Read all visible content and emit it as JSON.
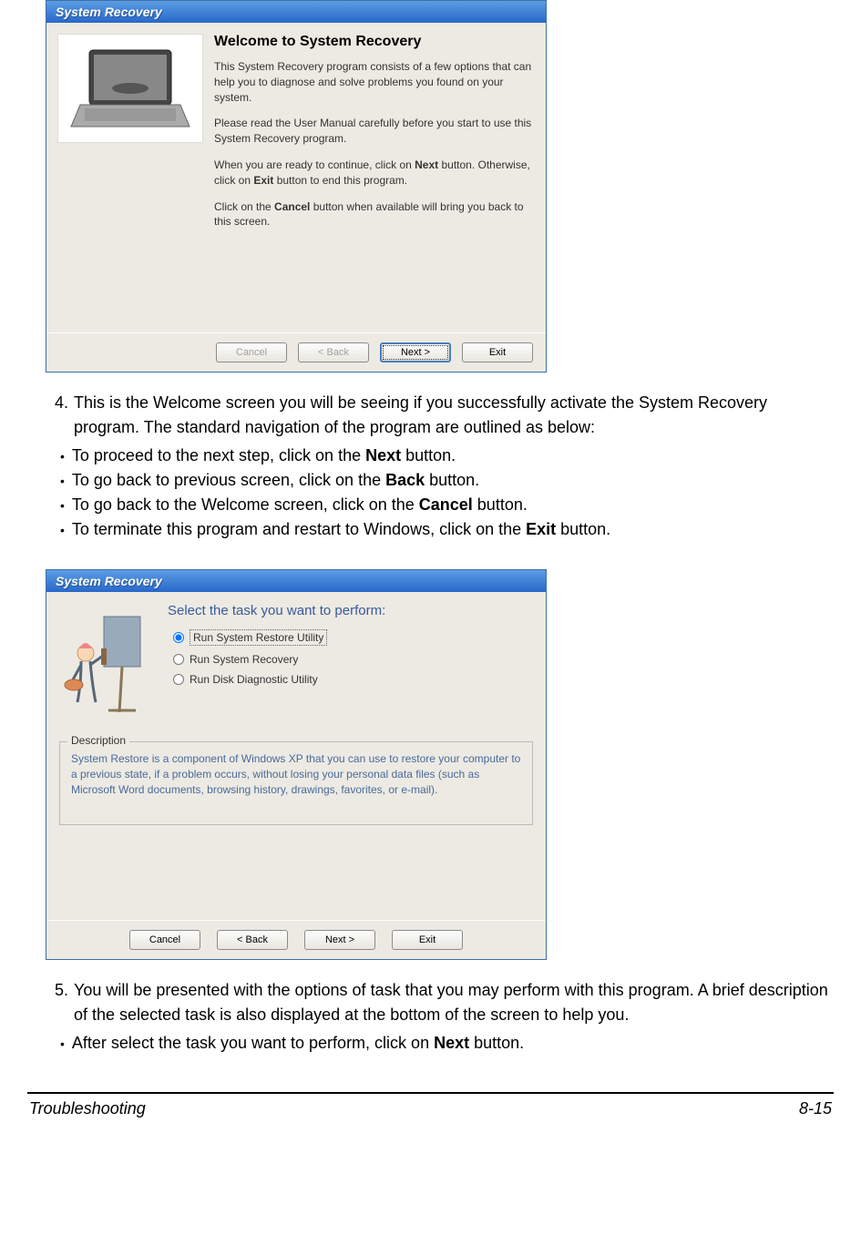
{
  "dialog1": {
    "title": "System Recovery",
    "heading": "Welcome to System Recovery",
    "para1": "This System Recovery program consists of a few options that can help you to diagnose and solve problems you found on your system.",
    "para2": "Please read the User Manual carefully before you start to use this System Recovery program.",
    "para3_pre": "When you are ready to continue, click on ",
    "para3_b1": "Next",
    "para3_mid": " button. Otherwise, click on ",
    "para3_b2": "Exit",
    "para3_post": " button to end this program.",
    "para4_pre": "Click on the ",
    "para4_b": "Cancel",
    "para4_post": " button when available will bring you back to this screen.",
    "buttons": {
      "cancel": "Cancel",
      "back": "< Back",
      "next": "Next >",
      "exit": "Exit"
    }
  },
  "step4": {
    "num": "4.",
    "text_a": "This is the Welcome screen you will be seeing if you successfully activate the System Recovery program.  The standard navigation of the program are outlined as below:",
    "bullets": [
      {
        "pre": "To proceed to the next step, click on the ",
        "b": "Next",
        "post": " button."
      },
      {
        "pre": "To go back to previous screen, click on the ",
        "b": "Back",
        "post": " button."
      },
      {
        "pre": "To go back to the Welcome screen, click on the ",
        "b": "Cancel",
        "post": " button."
      },
      {
        "pre": "To terminate this program and restart to Windows, click on the ",
        "b": "Exit",
        "post": " button."
      }
    ]
  },
  "dialog2": {
    "title": "System Recovery",
    "heading": "Select the task you want to perform:",
    "options": [
      "Run System Restore Utility",
      "Run System Recovery",
      "Run Disk Diagnostic Utility"
    ],
    "desc_label": "Description",
    "desc_text": "System Restore is a component of Windows XP that you can use to restore your computer to a previous state, if a problem occurs, without losing your personal data files (such as Microsoft Word documents, browsing history, drawings, favorites, or e-mail).",
    "buttons": {
      "cancel": "Cancel",
      "back": "< Back",
      "next": "Next >",
      "exit": "Exit"
    }
  },
  "step5": {
    "num": "5.",
    "text_a": "You will be presented with the options of task that you may perform with this program. A brief description of the selected task is also displayed at the bottom of the screen to help you.",
    "bullets": [
      {
        "pre": "After select the task you want to perform, click on ",
        "b": "Next",
        "post": " button."
      }
    ]
  },
  "footer": {
    "section": "Troubleshooting",
    "page": "8-15"
  }
}
